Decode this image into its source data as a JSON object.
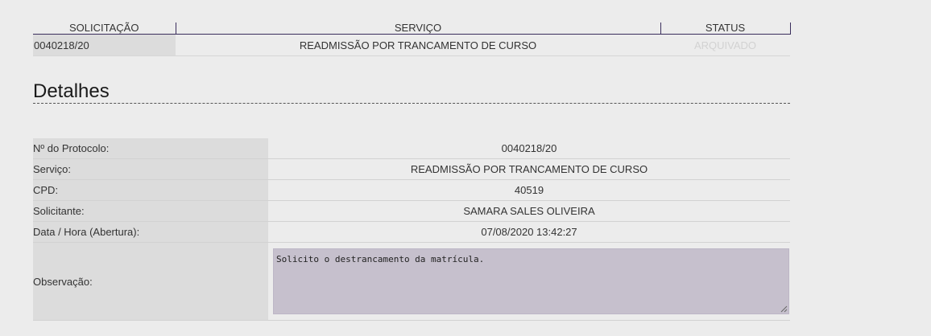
{
  "summary": {
    "headers": {
      "solicitacao": "SOLICITAÇÃO",
      "servico": "SERVIÇO",
      "status": "STATUS"
    },
    "row": {
      "solicitacao": "0040218/20",
      "servico": "READMISSÃO POR TRANCAMENTO DE CURSO",
      "status": "ARQUIVADO"
    }
  },
  "details": {
    "title": "Detalhes",
    "rows": [
      {
        "label": "Nº do Protocolo:",
        "value": "0040218/20"
      },
      {
        "label": "Serviço:",
        "value": "READMISSÃO POR TRANCAMENTO DE CURSO"
      },
      {
        "label": "CPD:",
        "value": "40519"
      },
      {
        "label": "Solicitante:",
        "value": "SAMARA SALES OLIVEIRA"
      },
      {
        "label": "Data / Hora (Abertura):",
        "value": "07/08/2020 13:42:27"
      }
    ],
    "observacao": {
      "label": "Observação:",
      "value": "Solicito o destrancamento da matrícula."
    }
  },
  "colors": {
    "header_rule": "#3a2d5c",
    "textarea_bg": "#c6c0cd",
    "status_muted": "#d2d2d2"
  }
}
